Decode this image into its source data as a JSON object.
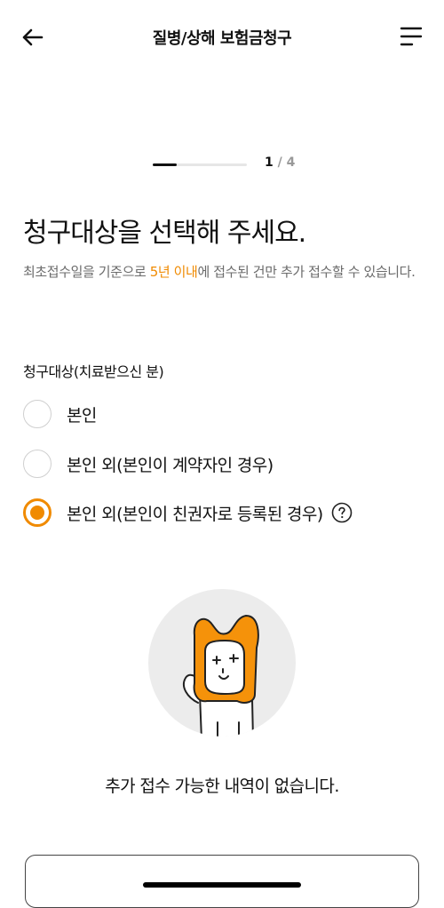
{
  "header": {
    "title": "질병/상해 보험금청구",
    "back_icon": "arrow-left-icon",
    "menu_icon": "hamburger-menu-icon"
  },
  "progress": {
    "current": "1",
    "separator": "/",
    "total": "4",
    "fraction": 0.25
  },
  "main": {
    "heading": "청구대상을 선택해 주세요.",
    "desc_before": "최초접수일을 기준으로 ",
    "desc_highlight": "5년 이내",
    "desc_after": "에 접수된 건만 추가 접수할 수 있습니다.",
    "section_label": "청구대상(치료받으신 분)"
  },
  "options": [
    {
      "label": "본인",
      "selected": false
    },
    {
      "label": "본인 외(본인이 계약자인 경우)",
      "selected": false
    },
    {
      "label": "본인 외(본인이 친권자로 등록된 경우)",
      "selected": true,
      "help_icon": "question-circle-icon"
    }
  ],
  "empty_state": {
    "illustration": "character-illustration",
    "text": "추가 접수 가능한 내역이 없습니다."
  },
  "colors": {
    "accent": "#f08a00",
    "text": "#111111",
    "muted": "#6b6b6b",
    "illustration_bg": "#ececec"
  }
}
